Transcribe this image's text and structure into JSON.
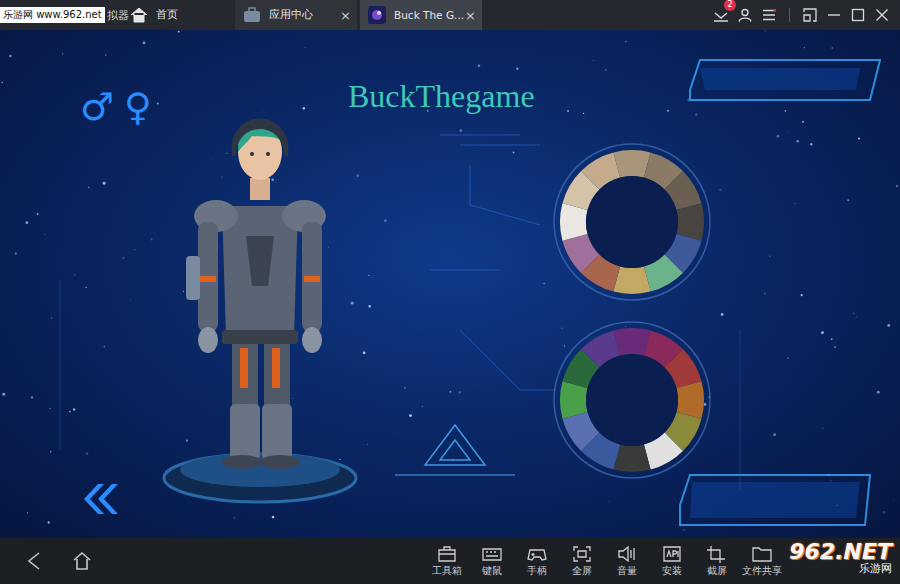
{
  "emulator": {
    "watermark": "乐游网 www.962.net",
    "logo_text": "拟器"
  },
  "tabs": [
    {
      "label": "首页",
      "selected": false,
      "closable": false
    },
    {
      "label": "应用中心",
      "selected": false,
      "closable": true
    },
    {
      "label": "Buck The G...",
      "selected": true,
      "closable": true
    }
  ],
  "tab_close_glyph": "×",
  "notifications": {
    "badge": "2"
  },
  "game": {
    "title": "BuckThegame",
    "genders": [
      {
        "symbol": "♂"
      },
      {
        "symbol": "♀"
      }
    ],
    "wheels": [
      {
        "swatches": [
          {
            "color": "#a8957a"
          },
          {
            "color": "#8a7a66"
          },
          {
            "color": "#6b5e52"
          },
          {
            "color": "#4a4440"
          },
          {
            "color": "#3f5a9a"
          },
          {
            "color": "#6bb38a"
          },
          {
            "color": "#c2a862"
          },
          {
            "color": "#a8664e"
          },
          {
            "color": "#a0709a"
          },
          {
            "color": "#eae6e2"
          },
          {
            "color": "#d4c3a8"
          },
          {
            "color": "#c3ab8c"
          }
        ]
      },
      {
        "swatches": [
          {
            "color": "#6a2a7a"
          },
          {
            "color": "#8a2a5a"
          },
          {
            "color": "#a03a3a"
          },
          {
            "color": "#b06a2a"
          },
          {
            "color": "#8a8a3a"
          },
          {
            "color": "#e0e0e0"
          },
          {
            "color": "#3a3a3a"
          },
          {
            "color": "#3a5aa0"
          },
          {
            "color": "#5a70b0"
          },
          {
            "color": "#4aa04a"
          },
          {
            "color": "#2a6a3a"
          },
          {
            "color": "#5a3a8a"
          }
        ]
      }
    ]
  },
  "toolbar": [
    {
      "label": "工具箱"
    },
    {
      "label": "键鼠"
    },
    {
      "label": "手柄"
    },
    {
      "label": "全屏"
    },
    {
      "label": "音量"
    },
    {
      "label": "安装"
    },
    {
      "label": "截屏"
    },
    {
      "label": "文件共享"
    }
  ],
  "bottom_watermark": {
    "brand": "962.NET",
    "name": "乐游网"
  }
}
